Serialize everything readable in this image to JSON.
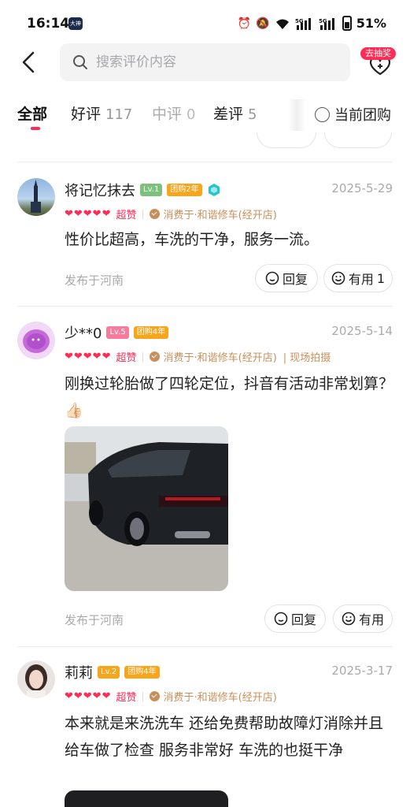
{
  "status_bar": {
    "time": "16:14",
    "app_badge": "大神",
    "network": "5G",
    "network2": "5G",
    "battery": "51%"
  },
  "header": {
    "search_placeholder": "搜索评价内容",
    "lottery_badge": "去抽奖"
  },
  "tabs": [
    {
      "label": "全部",
      "count": ""
    },
    {
      "label": "好评",
      "count": "117"
    },
    {
      "label": "中评",
      "count": "0"
    },
    {
      "label": "差评",
      "count": "5"
    }
  ],
  "group_filter": {
    "label": "当前团购"
  },
  "colors": {
    "accent": "#fe2c55",
    "shop": "#c98f5a",
    "level_green": "#7cc27c",
    "level_pink": "#f77b9a",
    "level_orange": "#f8a51c"
  },
  "reviews": [
    {
      "name": "将记忆抹去",
      "level": "Lv.1",
      "group_badge": "团购2年",
      "date": "2025-5-29",
      "rating_label": "超赞",
      "shop": "消费于·和谐修车(经开店)",
      "site_photo": "",
      "content": "性价比超高，车洗的干净，服务一流。",
      "location": "发布于河南",
      "reply_label": "回复",
      "useful_label": "有用",
      "useful_count": "1"
    },
    {
      "name": "少**0",
      "level": "Lv.5",
      "group_badge": "团购4年",
      "date": "2025-5-14",
      "rating_label": "超赞",
      "shop": "消费于·和谐修车(经开店)",
      "site_photo": "现场拍摄",
      "content": "刚换过轮胎做了四轮定位，抖音有活动非常划算？👍🏻",
      "location": "发布于河南",
      "reply_label": "回复",
      "useful_label": "有用",
      "useful_count": ""
    },
    {
      "name": "莉莉",
      "level": "Lv.2",
      "group_badge": "团购4年",
      "date": "2025-3-17",
      "rating_label": "超赞",
      "shop": "消费于·和谐修车(经开店)",
      "site_photo": "",
      "content": "本来就是来洗洗车 还给免费帮助故障灯消除并且给车做了检查 服务非常好 车洗的也挺干净",
      "location": "",
      "reply_label": "",
      "useful_label": "",
      "useful_count": ""
    }
  ]
}
